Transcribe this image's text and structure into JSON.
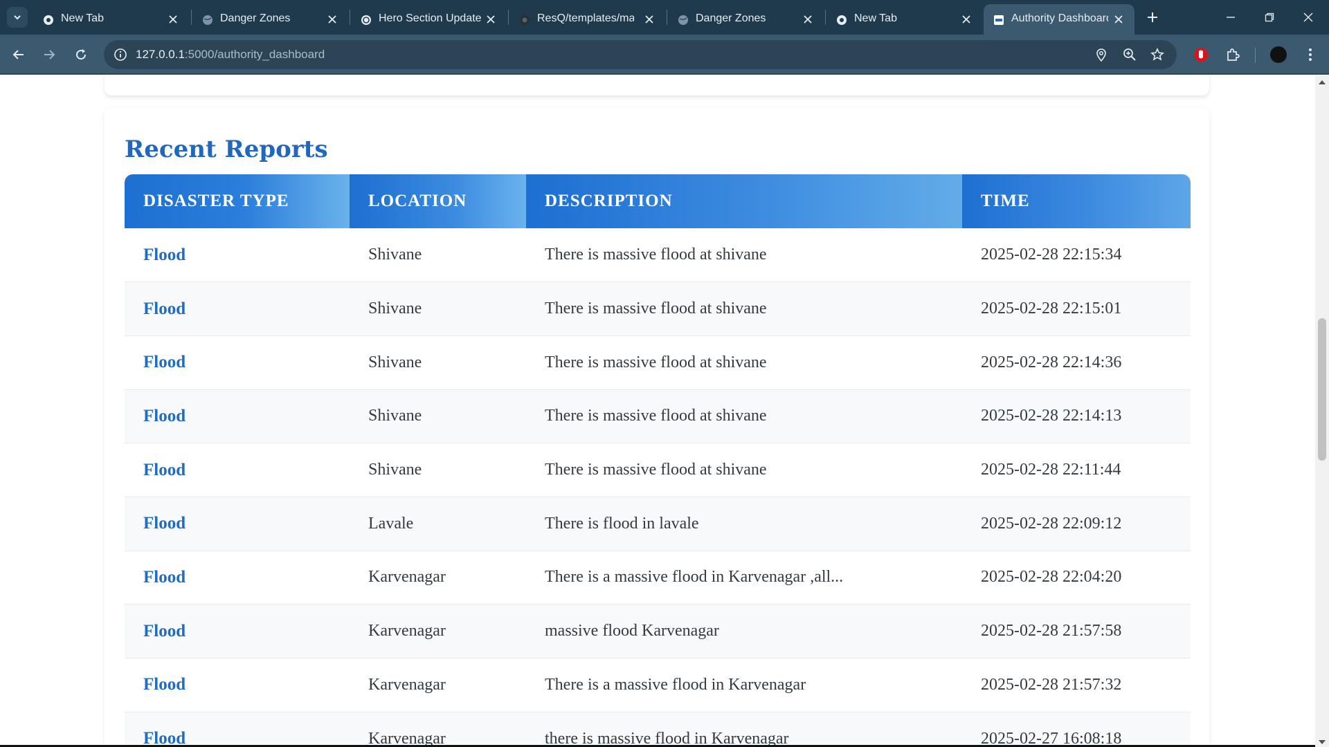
{
  "browser": {
    "tabs": [
      {
        "title": "New Tab",
        "favicon": "chrome-icon"
      },
      {
        "title": "Danger Zones",
        "favicon": "globe-icon"
      },
      {
        "title": "Hero Section Update",
        "favicon": "openai-icon"
      },
      {
        "title": "ResQ/templates/map",
        "favicon": "github-icon"
      },
      {
        "title": "Danger Zones",
        "favicon": "globe-icon"
      },
      {
        "title": "New Tab",
        "favicon": "chrome-icon"
      },
      {
        "title": "Authority Dashboard",
        "favicon": "resq-icon",
        "active": true
      }
    ],
    "url_host": "127.0.0.1",
    "url_rest": ":5000/authority_dashboard"
  },
  "page": {
    "section_title": "Recent Reports",
    "columns": [
      "DISASTER TYPE",
      "LOCATION",
      "DESCRIPTION",
      "TIME"
    ],
    "rows": [
      {
        "type": "Flood",
        "location": "Shivane",
        "description": "There is massive flood at shivane",
        "time": "2025-02-28 22:15:34"
      },
      {
        "type": "Flood",
        "location": "Shivane",
        "description": "There is massive flood at shivane",
        "time": "2025-02-28 22:15:01"
      },
      {
        "type": "Flood",
        "location": "Shivane",
        "description": "There is massive flood at shivane",
        "time": "2025-02-28 22:14:36"
      },
      {
        "type": "Flood",
        "location": "Shivane",
        "description": "There is massive flood at shivane",
        "time": "2025-02-28 22:14:13"
      },
      {
        "type": "Flood",
        "location": "Shivane",
        "description": "There is massive flood at shivane",
        "time": "2025-02-28 22:11:44"
      },
      {
        "type": "Flood",
        "location": "Lavale",
        "description": "There is flood in lavale",
        "time": "2025-02-28 22:09:12"
      },
      {
        "type": "Flood",
        "location": "Karvenagar",
        "description": "There is a massive flood in Karvenagar ,all...",
        "time": "2025-02-28 22:04:20"
      },
      {
        "type": "Flood",
        "location": "Karvenagar",
        "description": "massive flood Karvenagar",
        "time": "2025-02-28 21:57:58"
      },
      {
        "type": "Flood",
        "location": "Karvenagar",
        "description": "There is a massive flood in Karvenagar",
        "time": "2025-02-28 21:57:32"
      },
      {
        "type": "Flood",
        "location": "Karvenagar",
        "description": "there is massive flood in Karvenagar",
        "time": "2025-02-27 16:08:18"
      }
    ]
  },
  "colors": {
    "accent": "#2167bd",
    "header_gradient_start": "#1d6fd1",
    "header_gradient_end": "#6bb2ec",
    "chrome_dark": "#1f3a4d",
    "chrome_toolbar": "#3b5a70"
  }
}
